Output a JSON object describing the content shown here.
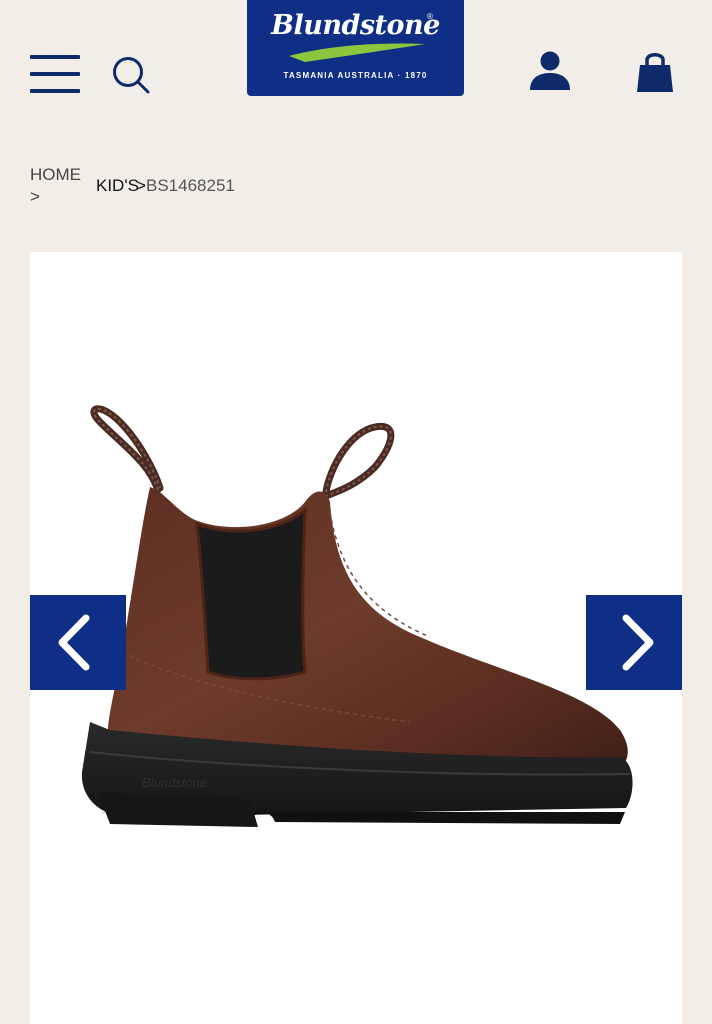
{
  "header": {
    "logo": {
      "brand": "Blundstone",
      "tagline": "TASMANIA AUSTRALIA · 1870",
      "colors": {
        "background": "#0f2f86",
        "swoosh": "#8cc63f"
      }
    },
    "icons": {
      "menu": "hamburger-menu-icon",
      "search": "search-icon",
      "account": "user-icon",
      "cart": "shopping-bag-icon"
    }
  },
  "breadcrumb": {
    "home": "HOME",
    "sep1": ">",
    "kids": "KID'S",
    "sep2": ">",
    "current": "BS1468251"
  },
  "gallery": {
    "image": "brown-leather-chelsea-boot",
    "prev_icon": "chevron-left-icon",
    "next_icon": "chevron-right-icon"
  },
  "theme": {
    "page_background": "#f2eee7",
    "accent": "#0f2f86",
    "icon_color": "#0f2a6b"
  }
}
